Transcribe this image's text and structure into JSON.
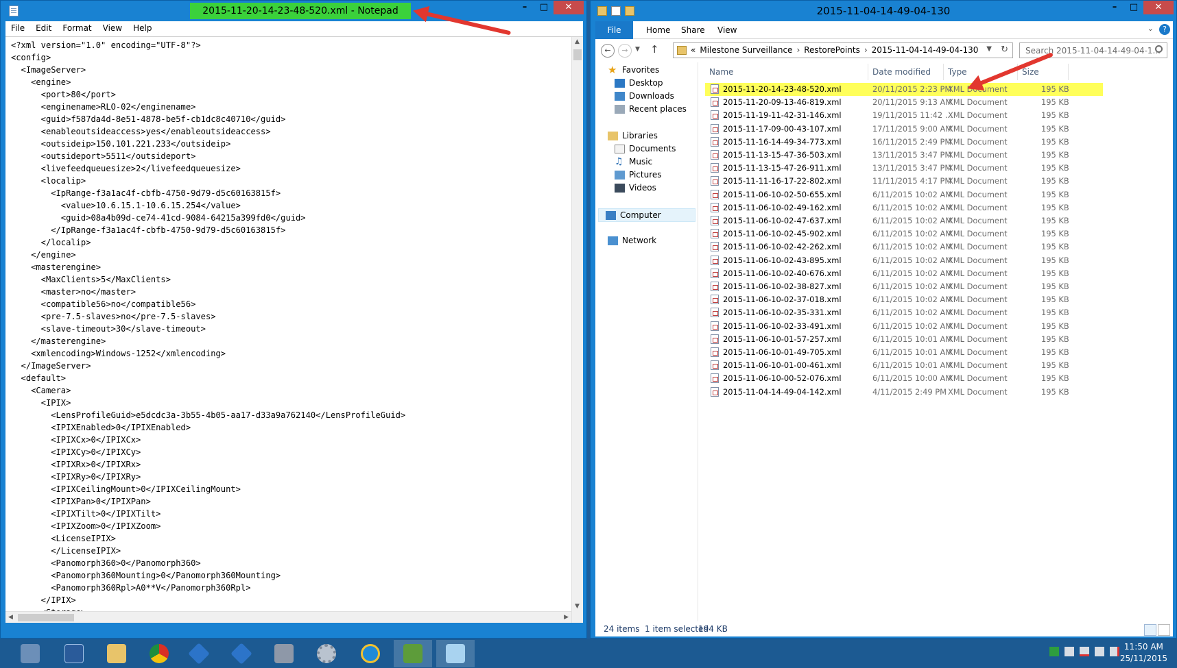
{
  "notepad": {
    "title": "2015-11-20-14-23-48-520.xml - Notepad",
    "menu": [
      "File",
      "Edit",
      "Format",
      "View",
      "Help"
    ],
    "lines": [
      "<?xml version=\"1.0\" encoding=\"UTF-8\"?>",
      "<config>",
      "  <ImageServer>",
      "    <engine>",
      "      <port>80</port>",
      "      <enginename>RLO-02</enginename>",
      "      <guid>f587da4d-8e51-4878-be5f-cb1dc8c40710</guid>",
      "      <enableoutsideaccess>yes</enableoutsideaccess>",
      "      <outsideip>150.101.221.233</outsideip>",
      "      <outsideport>5511</outsideport>",
      "      <livefeedqueuesize>2</livefeedqueuesize>",
      "      <localip>",
      "        <IpRange-f3a1ac4f-cbfb-4750-9d79-d5c60163815f>",
      "          <value>10.6.15.1-10.6.15.254</value>",
      "          <guid>08a4b09d-ce74-41cd-9084-64215a399fd0</guid>",
      "        </IpRange-f3a1ac4f-cbfb-4750-9d79-d5c60163815f>",
      "      </localip>",
      "    </engine>",
      "    <masterengine>",
      "      <MaxClients>5</MaxClients>",
      "      <master>no</master>",
      "      <compatible56>no</compatible56>",
      "      <pre-7.5-slaves>no</pre-7.5-slaves>",
      "      <slave-timeout>30</slave-timeout>",
      "    </masterengine>",
      "    <xmlencoding>Windows-1252</xmlencoding>",
      "  </ImageServer>",
      "  <default>",
      "    <Camera>",
      "      <IPIX>",
      "        <LensProfileGuid>e5dcdc3a-3b55-4b05-aa17-d33a9a762140</LensProfileGuid>",
      "        <IPIXEnabled>0</IPIXEnabled>",
      "        <IPIXCx>0</IPIXCx>",
      "        <IPIXCy>0</IPIXCy>",
      "        <IPIXRx>0</IPIXRx>",
      "        <IPIXRy>0</IPIXRy>",
      "        <IPIXCeilingMount>0</IPIXCeilingMount>",
      "        <IPIXPan>0</IPIXPan>",
      "        <IPIXTilt>0</IPIXTilt>",
      "        <IPIXZoom>0</IPIXZoom>",
      "        <LicenseIPIX>",
      "        </LicenseIPIX>",
      "        <Panomorph360>0</Panomorph360>",
      "        <Panomorph360Mounting>0</Panomorph360Mounting>",
      "        <Panomorph360Rpl>A0**V</Panomorph360Rpl>",
      "      </IPIX>",
      "      <Storage>"
    ]
  },
  "explorer": {
    "title": "2015-11-04-14-49-04-130",
    "ribbon_tabs": [
      "File",
      "Home",
      "Share",
      "View"
    ],
    "breadcrumb": [
      "«",
      "Milestone Surveillance",
      "RestorePoints",
      "2015-11-04-14-49-04-130"
    ],
    "search_placeholder": "Search 2015-11-04-14-49-04-1...",
    "nav": {
      "favorites": "Favorites",
      "desktop": "Desktop",
      "downloads": "Downloads",
      "recent": "Recent places",
      "libraries": "Libraries",
      "documents": "Documents",
      "music": "Music",
      "pictures": "Pictures",
      "videos": "Videos",
      "computer": "Computer",
      "network": "Network"
    },
    "columns": {
      "name": "Name",
      "date": "Date modified",
      "type": "Type",
      "size": "Size"
    },
    "files": [
      {
        "name": "2015-11-20-14-23-48-520.xml",
        "date": "20/11/2015 2:23 PM",
        "type": "XML Document",
        "size": "195 KB"
      },
      {
        "name": "2015-11-20-09-13-46-819.xml",
        "date": "20/11/2015 9:13 AM",
        "type": "XML Document",
        "size": "195 KB"
      },
      {
        "name": "2015-11-19-11-42-31-146.xml",
        "date": "19/11/2015 11:42 ...",
        "type": "XML Document",
        "size": "195 KB"
      },
      {
        "name": "2015-11-17-09-00-43-107.xml",
        "date": "17/11/2015 9:00 AM",
        "type": "XML Document",
        "size": "195 KB"
      },
      {
        "name": "2015-11-16-14-49-34-773.xml",
        "date": "16/11/2015 2:49 PM",
        "type": "XML Document",
        "size": "195 KB"
      },
      {
        "name": "2015-11-13-15-47-36-503.xml",
        "date": "13/11/2015 3:47 PM",
        "type": "XML Document",
        "size": "195 KB"
      },
      {
        "name": "2015-11-13-15-47-26-911.xml",
        "date": "13/11/2015 3:47 PM",
        "type": "XML Document",
        "size": "195 KB"
      },
      {
        "name": "2015-11-11-16-17-22-802.xml",
        "date": "11/11/2015 4:17 PM",
        "type": "XML Document",
        "size": "195 KB"
      },
      {
        "name": "2015-11-06-10-02-50-655.xml",
        "date": "6/11/2015 10:02 AM",
        "type": "XML Document",
        "size": "195 KB"
      },
      {
        "name": "2015-11-06-10-02-49-162.xml",
        "date": "6/11/2015 10:02 AM",
        "type": "XML Document",
        "size": "195 KB"
      },
      {
        "name": "2015-11-06-10-02-47-637.xml",
        "date": "6/11/2015 10:02 AM",
        "type": "XML Document",
        "size": "195 KB"
      },
      {
        "name": "2015-11-06-10-02-45-902.xml",
        "date": "6/11/2015 10:02 AM",
        "type": "XML Document",
        "size": "195 KB"
      },
      {
        "name": "2015-11-06-10-02-42-262.xml",
        "date": "6/11/2015 10:02 AM",
        "type": "XML Document",
        "size": "195 KB"
      },
      {
        "name": "2015-11-06-10-02-43-895.xml",
        "date": "6/11/2015 10:02 AM",
        "type": "XML Document",
        "size": "195 KB"
      },
      {
        "name": "2015-11-06-10-02-40-676.xml",
        "date": "6/11/2015 10:02 AM",
        "type": "XML Document",
        "size": "195 KB"
      },
      {
        "name": "2015-11-06-10-02-38-827.xml",
        "date": "6/11/2015 10:02 AM",
        "type": "XML Document",
        "size": "195 KB"
      },
      {
        "name": "2015-11-06-10-02-37-018.xml",
        "date": "6/11/2015 10:02 AM",
        "type": "XML Document",
        "size": "195 KB"
      },
      {
        "name": "2015-11-06-10-02-35-331.xml",
        "date": "6/11/2015 10:02 AM",
        "type": "XML Document",
        "size": "195 KB"
      },
      {
        "name": "2015-11-06-10-02-33-491.xml",
        "date": "6/11/2015 10:02 AM",
        "type": "XML Document",
        "size": "195 KB"
      },
      {
        "name": "2015-11-06-10-01-57-257.xml",
        "date": "6/11/2015 10:01 AM",
        "type": "XML Document",
        "size": "195 KB"
      },
      {
        "name": "2015-11-06-10-01-49-705.xml",
        "date": "6/11/2015 10:01 AM",
        "type": "XML Document",
        "size": "195 KB"
      },
      {
        "name": "2015-11-06-10-01-00-461.xml",
        "date": "6/11/2015 10:01 AM",
        "type": "XML Document",
        "size": "195 KB"
      },
      {
        "name": "2015-11-06-10-00-52-076.xml",
        "date": "6/11/2015 10:00 AM",
        "type": "XML Document",
        "size": "195 KB"
      },
      {
        "name": "2015-11-04-14-49-04-142.xml",
        "date": "4/11/2015 2:49 PM",
        "type": "XML Document",
        "size": "195 KB"
      }
    ],
    "status": {
      "count": "24 items",
      "selected": "1 item selected",
      "size": "194 KB"
    }
  },
  "clock": {
    "time": "11:50 AM",
    "date": "25/11/2015"
  },
  "colors": {
    "highlight": "#ffff5a",
    "arrow": "#e2372f",
    "title_highlight": "#3bd13b",
    "taskbar": "#1c5a92"
  }
}
